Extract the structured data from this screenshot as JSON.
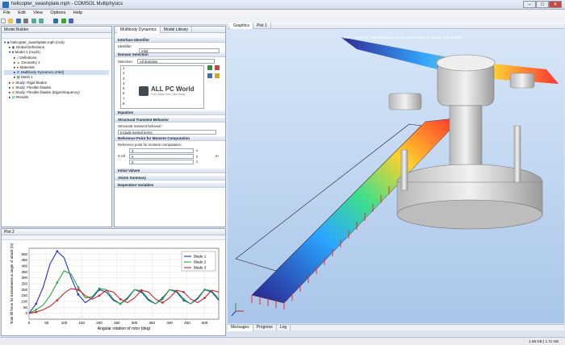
{
  "window": {
    "title": "helicopter_swashplate.mph - COMSOL Multiphysics",
    "min": "–",
    "max": "□",
    "close": "✕"
  },
  "menu": [
    "File",
    "Edit",
    "View",
    "Options",
    "Help"
  ],
  "model_builder": {
    "tab": "Model Builder",
    "items": [
      "helicopter_swashplate.mph (root)",
      "Global Definitions",
      "Model 1 (mod1)",
      "Definitions",
      "Geometry 1",
      "Materials",
      "Multibody Dynamics (mbd)",
      "Mesh 1",
      "Study: Rigid blades",
      "Study: Flexible blades",
      "Study: Flexible blades (Eigenfrequency)",
      "Results"
    ]
  },
  "settings": {
    "tabs": [
      "Multibody Dynamics",
      "Model Library"
    ],
    "sections": {
      "interface_id": "Interface Identifier",
      "identifier_label": "Identifier:",
      "identifier_value": "mbd",
      "domain_selection": "Domain Selection",
      "selection_label": "Selection:",
      "selection_value": "All domains",
      "domain_list": [
        "1",
        "2",
        "3",
        "4",
        "5",
        "6",
        "7",
        "8"
      ],
      "equation": "Equation",
      "transient": "Structural Transient Behavior",
      "transient_label": "Structural transient behavior:",
      "transient_value": "Include inertial terms",
      "ref_point": "Reference Point for Moment Computation",
      "ref_label": "Reference point for moment computation:",
      "ref_sym": "X ref",
      "ref_values": [
        "0",
        "0",
        "0"
      ],
      "ref_axes": [
        "x",
        "y",
        "z"
      ],
      "ref_unit": "m",
      "initial": "Initial Values",
      "joints": "Joints Summary",
      "dependent": "Dependent Variables"
    }
  },
  "watermark": {
    "title": "ALL PC World",
    "sub": "Free Apps One Click Away"
  },
  "graphics": {
    "tabs": [
      "Graphics",
      "Plot 1"
    ],
    "overlay": "Time=... Surface: Total displacement (m) Arrow Surface: Stress and velocity"
  },
  "messages": {
    "tabs": [
      "Messages",
      "Progress",
      "Log"
    ]
  },
  "status_mem": "1.88 GB | 1.71 GB",
  "plot2": {
    "tab": "Plot 2"
  },
  "chart_data": {
    "type": "line",
    "title": "",
    "xlabel": "Angular rotation of rotor (deg)",
    "ylabel": "Total lift force for instantaneous angle of attack (N)",
    "xlim": [
      0,
      540
    ],
    "ylim": [
      -50,
      550
    ],
    "xticks": [
      0,
      50,
      100,
      150,
      200,
      250,
      300,
      350,
      400,
      450,
      500
    ],
    "yticks": [
      0,
      50,
      100,
      150,
      200,
      250,
      300,
      350,
      400,
      450,
      500
    ],
    "legend_position": "top-right",
    "series": [
      {
        "name": "Blade 1",
        "color": "#2233cc",
        "x": [
          0,
          20,
          40,
          60,
          80,
          100,
          120,
          140,
          160,
          180,
          200,
          220,
          240,
          260,
          280,
          300,
          320,
          340,
          360,
          380,
          400,
          420,
          440,
          460,
          480,
          500,
          520,
          540
        ],
        "y": [
          0,
          80,
          220,
          420,
          525,
          470,
          300,
          160,
          90,
          130,
          200,
          180,
          110,
          80,
          130,
          200,
          180,
          110,
          80,
          130,
          200,
          180,
          110,
          80,
          130,
          200,
          180,
          110
        ]
      },
      {
        "name": "Blade 2",
        "color": "#22aa33",
        "x": [
          0,
          20,
          40,
          60,
          80,
          100,
          120,
          140,
          160,
          180,
          200,
          220,
          240,
          260,
          280,
          300,
          320,
          340,
          360,
          380,
          400,
          420,
          440,
          460,
          480,
          500,
          520,
          540
        ],
        "y": [
          0,
          30,
          70,
          150,
          260,
          360,
          330,
          220,
          130,
          140,
          210,
          200,
          120,
          80,
          120,
          200,
          190,
          120,
          80,
          120,
          200,
          190,
          120,
          80,
          120,
          200,
          190,
          120
        ]
      },
      {
        "name": "Blade 3",
        "color": "#cc2233",
        "x": [
          0,
          20,
          40,
          60,
          80,
          100,
          120,
          140,
          160,
          180,
          200,
          220,
          240,
          260,
          280,
          300,
          320,
          340,
          360,
          380,
          400,
          420,
          440,
          460,
          480,
          500,
          520,
          540
        ],
        "y": [
          0,
          10,
          30,
          60,
          110,
          170,
          210,
          200,
          150,
          120,
          150,
          195,
          180,
          120,
          90,
          130,
          195,
          180,
          120,
          90,
          130,
          195,
          180,
          120,
          90,
          130,
          195,
          180
        ]
      }
    ]
  }
}
